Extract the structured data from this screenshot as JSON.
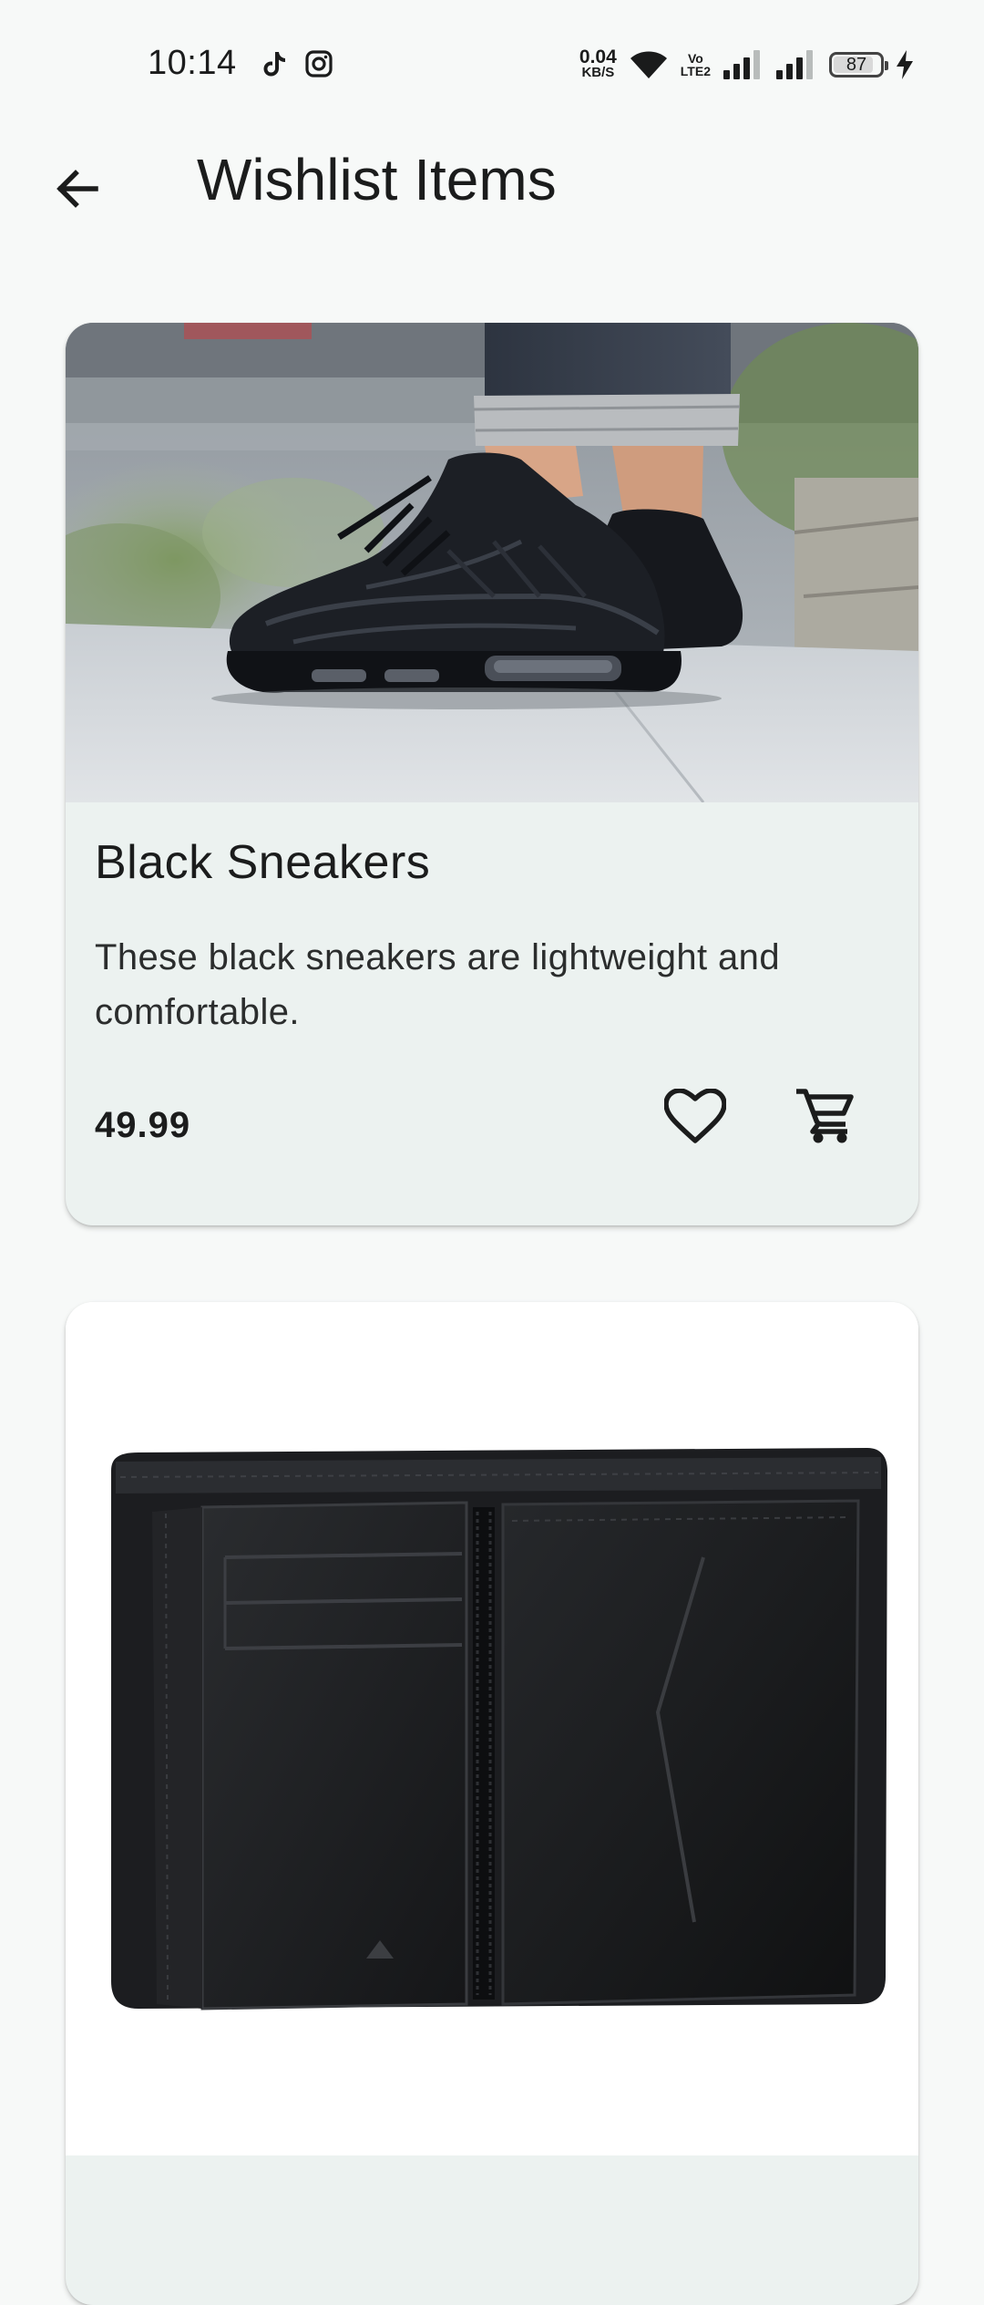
{
  "status_bar": {
    "time": "10:14",
    "net_speed_value": "0.04",
    "net_speed_unit": "KB/S",
    "volte_top": "Vo",
    "volte_bottom": "LTE2",
    "battery_level": "87",
    "battery_fraction": 0.87
  },
  "app_bar": {
    "title": "Wishlist Items",
    "back_icon": "arrow-back-icon"
  },
  "products": [
    {
      "name": "Black Sneakers",
      "description": "These black sneakers are lightweight and comfortable.",
      "price": "49.99",
      "image": "black-sneakers-photo",
      "favorite_icon": "heart-outline-icon",
      "cart_icon": "shopping-cart-icon"
    },
    {
      "image": "black-wallet-photo"
    }
  ],
  "colors": {
    "background": "#f7f9f8",
    "card": "#ecf2f0",
    "text": "#1b1c1c"
  }
}
